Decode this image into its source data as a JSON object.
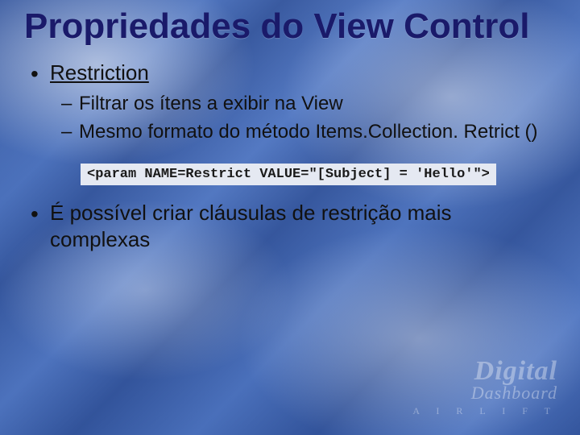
{
  "title": "Propriedades do View Control",
  "bullets": {
    "b1": {
      "label": "Restriction",
      "sub": [
        "Filtrar os ítens a exibir na View",
        "Mesmo formato do método Items.Collection. Retrict ()"
      ]
    },
    "code": "<param NAME=Restrict VALUE=\"[Subject] = 'Hello'\">",
    "b2": {
      "label": "É possível criar cláusulas de restrição mais complexas"
    }
  },
  "logo": {
    "brand": "Digital",
    "sub": "Dashboard",
    "tag": "A I R L I F T"
  }
}
